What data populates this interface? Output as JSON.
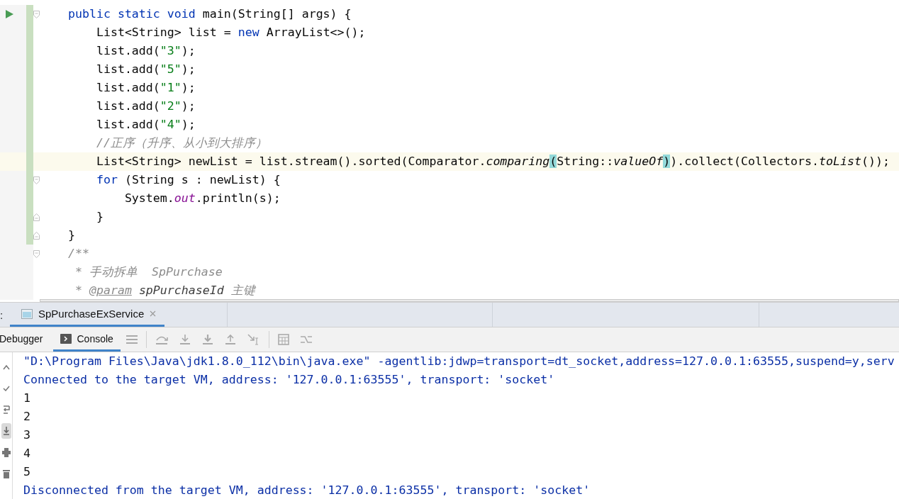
{
  "editor": {
    "lines": [
      {
        "run": true,
        "changed": true,
        "current": false,
        "fold_open": true,
        "fold_close": false,
        "tokens": [
          {
            "kind": "kw",
            "text": "    public static void "
          },
          {
            "kind": "plain",
            "text": "main(String[] args) {"
          }
        ]
      },
      {
        "run": false,
        "changed": true,
        "current": false,
        "fold_open": false,
        "fold_close": false,
        "tokens": [
          {
            "kind": "plain",
            "text": "        List<String> list = "
          },
          {
            "kind": "kw",
            "text": "new "
          },
          {
            "kind": "plain",
            "text": "ArrayList<>();"
          }
        ]
      },
      {
        "run": false,
        "changed": true,
        "current": false,
        "fold_open": false,
        "fold_close": false,
        "tokens": [
          {
            "kind": "plain",
            "text": "        list.add("
          },
          {
            "kind": "str",
            "text": "\"3\""
          },
          {
            "kind": "plain",
            "text": ");"
          }
        ]
      },
      {
        "run": false,
        "changed": true,
        "current": false,
        "fold_open": false,
        "fold_close": false,
        "tokens": [
          {
            "kind": "plain",
            "text": "        list.add("
          },
          {
            "kind": "str",
            "text": "\"5\""
          },
          {
            "kind": "plain",
            "text": ");"
          }
        ]
      },
      {
        "run": false,
        "changed": true,
        "current": false,
        "fold_open": false,
        "fold_close": false,
        "tokens": [
          {
            "kind": "plain",
            "text": "        list.add("
          },
          {
            "kind": "str",
            "text": "\"1\""
          },
          {
            "kind": "plain",
            "text": ");"
          }
        ]
      },
      {
        "run": false,
        "changed": true,
        "current": false,
        "fold_open": false,
        "fold_close": false,
        "tokens": [
          {
            "kind": "plain",
            "text": "        list.add("
          },
          {
            "kind": "str",
            "text": "\"2\""
          },
          {
            "kind": "plain",
            "text": ");"
          }
        ]
      },
      {
        "run": false,
        "changed": true,
        "current": false,
        "fold_open": false,
        "fold_close": false,
        "tokens": [
          {
            "kind": "plain",
            "text": "        list.add("
          },
          {
            "kind": "str",
            "text": "\"4\""
          },
          {
            "kind": "plain",
            "text": ");"
          }
        ]
      },
      {
        "run": false,
        "changed": true,
        "current": false,
        "fold_open": false,
        "fold_close": false,
        "tokens": [
          {
            "kind": "comment",
            "text": "        //正序（升序、从小到大排序）"
          }
        ]
      },
      {
        "run": false,
        "changed": true,
        "current": true,
        "fold_open": false,
        "fold_close": false,
        "tokens": [
          {
            "kind": "plain",
            "text": "        List<String> newList = list.stream().sorted(Comparator."
          },
          {
            "kind": "italic",
            "text": "comparing"
          },
          {
            "kind": "match",
            "text": "("
          },
          {
            "kind": "plain",
            "text": "String::"
          },
          {
            "kind": "italic",
            "text": "valueOf"
          },
          {
            "kind": "match",
            "text": ")"
          },
          {
            "kind": "plain",
            "text": ").collect(Collectors."
          },
          {
            "kind": "italic",
            "text": "toList"
          },
          {
            "kind": "plain",
            "text": "());"
          }
        ]
      },
      {
        "run": false,
        "changed": true,
        "current": false,
        "fold_open": true,
        "fold_close": false,
        "tokens": [
          {
            "kind": "kw",
            "text": "        for "
          },
          {
            "kind": "plain",
            "text": "(String s : newList) {"
          }
        ]
      },
      {
        "run": false,
        "changed": true,
        "current": false,
        "fold_open": false,
        "fold_close": false,
        "tokens": [
          {
            "kind": "plain",
            "text": "            System."
          },
          {
            "kind": "field",
            "text": "out"
          },
          {
            "kind": "plain",
            "text": ".println(s);"
          }
        ]
      },
      {
        "run": false,
        "changed": true,
        "current": false,
        "fold_open": false,
        "fold_close": true,
        "tokens": [
          {
            "kind": "plain",
            "text": "        }"
          }
        ]
      },
      {
        "run": false,
        "changed": true,
        "current": false,
        "fold_open": false,
        "fold_close": true,
        "tokens": [
          {
            "kind": "plain",
            "text": "    }"
          }
        ]
      },
      {
        "run": false,
        "changed": false,
        "current": false,
        "fold_open": true,
        "fold_close": false,
        "tokens": [
          {
            "kind": "comment",
            "text": "    /**"
          }
        ]
      },
      {
        "run": false,
        "changed": false,
        "current": false,
        "fold_open": false,
        "fold_close": false,
        "tokens": [
          {
            "kind": "comment",
            "text": "     * 手动拆单  SpPurchase"
          }
        ]
      },
      {
        "run": false,
        "changed": false,
        "current": false,
        "fold_open": false,
        "fold_close": false,
        "tokens": [
          {
            "kind": "comment",
            "text": "     * "
          },
          {
            "kind": "doctag",
            "text": "@param"
          },
          {
            "kind": "docparam",
            "text": " spPurchaseId"
          },
          {
            "kind": "comment",
            "text": " 主键"
          }
        ]
      }
    ]
  },
  "tool_window": {
    "label": ":",
    "tabs": [
      {
        "label": "SpPurchaseExService",
        "selected": true
      }
    ],
    "view_tabs": [
      {
        "label": "Debugger",
        "selected": false
      },
      {
        "label": "Console",
        "selected": true
      }
    ],
    "side_tools": [
      {
        "kind": "up",
        "selected": false
      },
      {
        "kind": "check",
        "selected": false
      },
      {
        "kind": "wrap",
        "selected": false
      },
      {
        "kind": "scroll-end",
        "selected": true
      },
      {
        "kind": "print",
        "selected": false
      },
      {
        "kind": "trash",
        "selected": false
      }
    ],
    "console": [
      {
        "kind": "system",
        "text": "\"D:\\Program Files\\Java\\jdk1.8.0_112\\bin\\java.exe\" -agentlib:jdwp=transport=dt_socket,address=127.0.0.1:63555,suspend=y,serv"
      },
      {
        "kind": "system",
        "text": "Connected to the target VM, address: '127.0.0.1:63555', transport: 'socket'"
      },
      {
        "kind": "output",
        "text": "1"
      },
      {
        "kind": "output",
        "text": "2"
      },
      {
        "kind": "output",
        "text": "3"
      },
      {
        "kind": "output",
        "text": "4"
      },
      {
        "kind": "output",
        "text": "5"
      },
      {
        "kind": "system",
        "text": "Disconnected from the target VM, address: '127.0.0.1:63555', transport: 'socket'"
      }
    ]
  }
}
